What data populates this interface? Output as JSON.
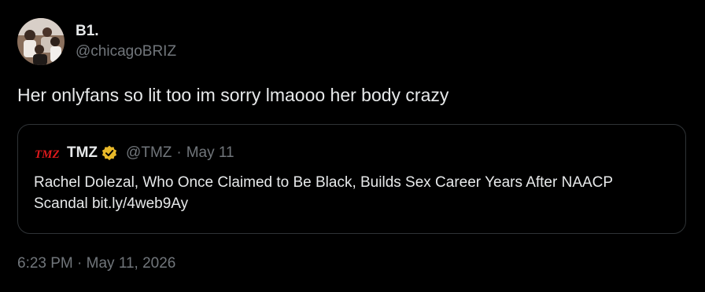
{
  "author": {
    "display_name": "B1.",
    "handle": "@chicagoBRIZ",
    "avatar_icon": "avatar-photo"
  },
  "tweet": {
    "text": "Her onlyfans so lit too im sorry lmaooo her body crazy"
  },
  "quote": {
    "logo_text": "TMZ",
    "logo_color": "#e0191c",
    "name": "TMZ",
    "verified_icon": "gold-verified-badge-icon",
    "verified_color": "#e8b829",
    "handle": "@TMZ",
    "separator": "·",
    "date": "May 11",
    "text": "Rachel Dolezal, Who Once Claimed to Be Black, Builds Sex Career Years After NAACP Scandal bit.ly/4web9Ay"
  },
  "meta": {
    "time": "6:23 PM",
    "separator": "·",
    "date": "May 11, 2026"
  },
  "colors": {
    "background": "#000000",
    "text_primary": "#e7e9ea",
    "text_secondary": "#71767b",
    "border": "#2f3336"
  }
}
